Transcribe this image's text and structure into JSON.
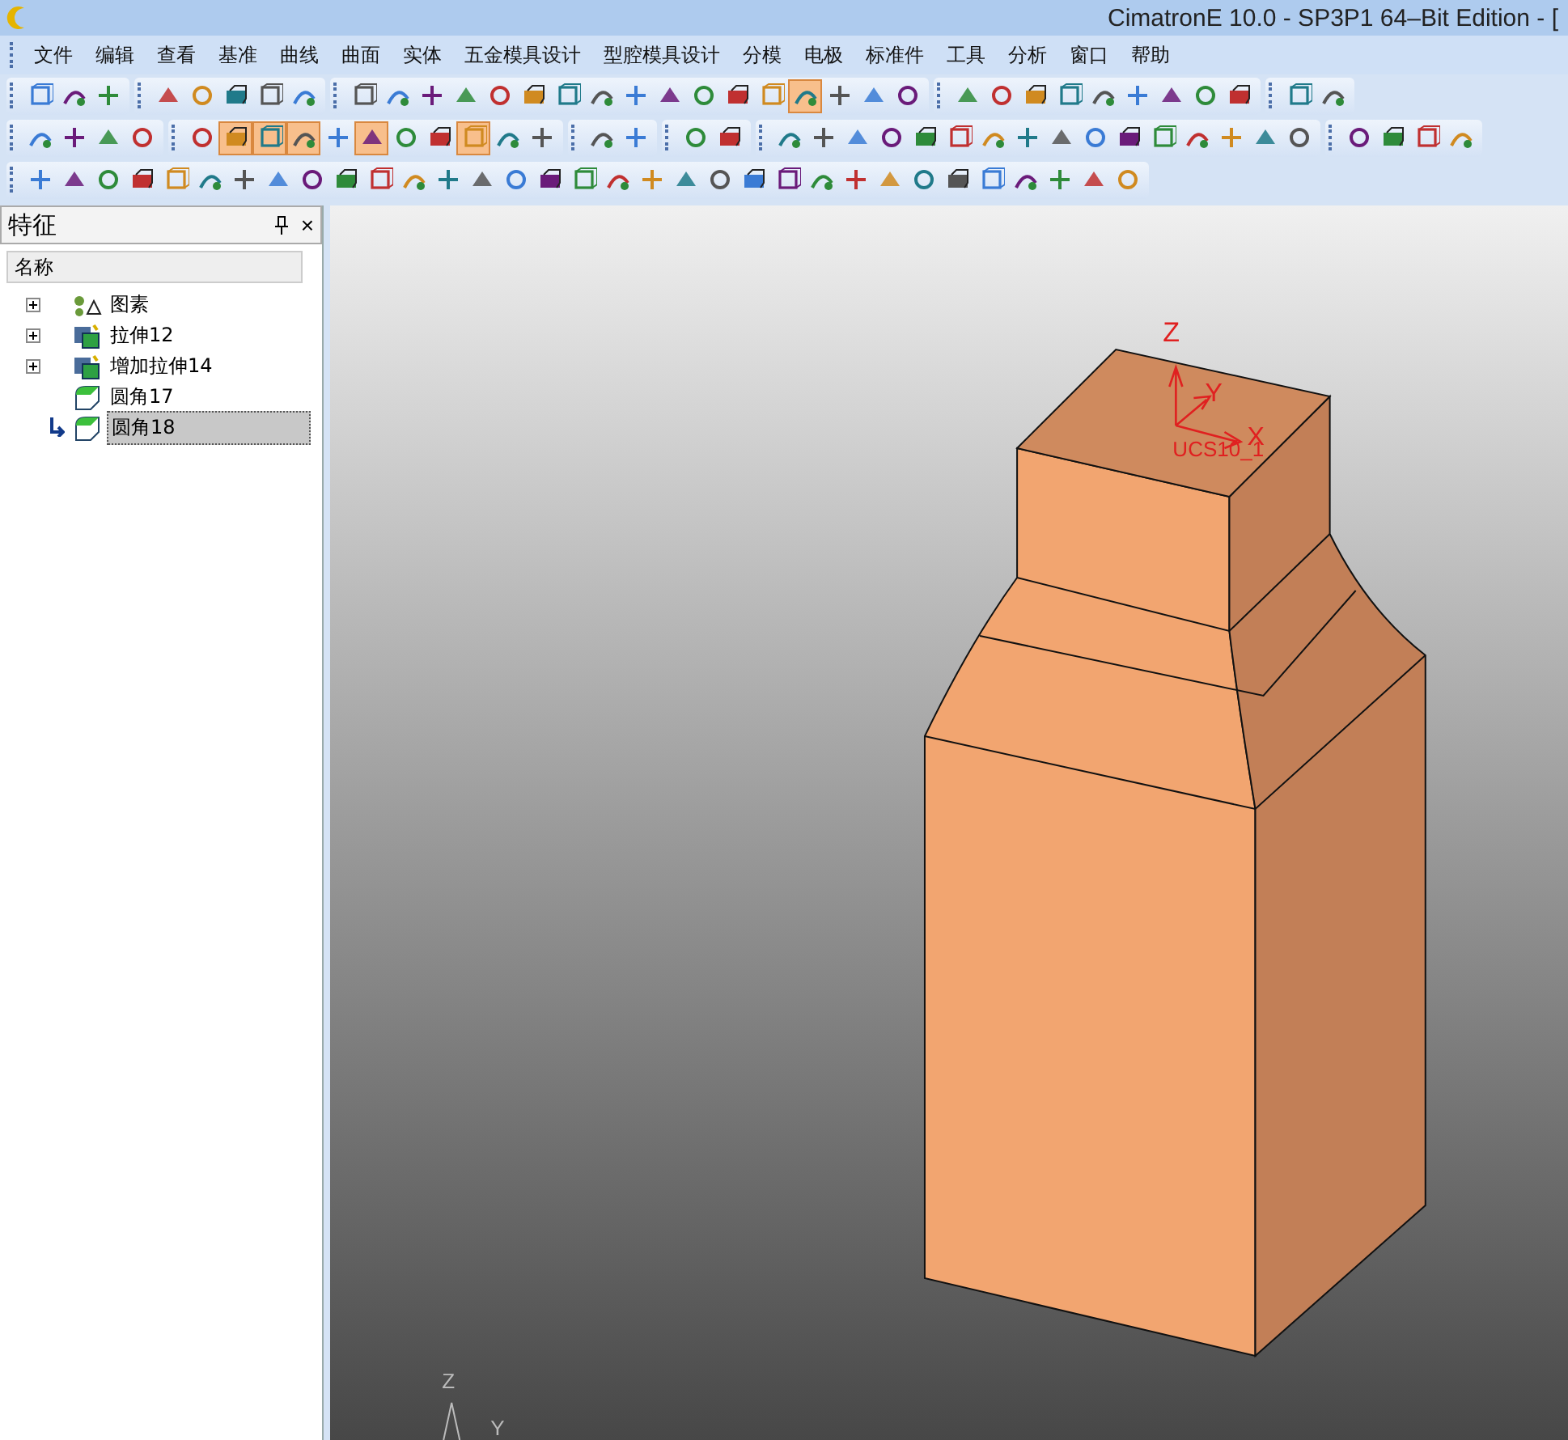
{
  "window": {
    "title": "CimatronE 10.0 - SP3P1 64–Bit Edition - ["
  },
  "menu": [
    "文件",
    "编辑",
    "查看",
    "基准",
    "曲线",
    "曲面",
    "实体",
    "五金模具设计",
    "型腔模具设计",
    "分模",
    "电极",
    "标准件",
    "工具",
    "分析",
    "窗口",
    "帮助"
  ],
  "toolbars": [
    {
      "groups": [
        [
          {
            "selected": false
          },
          {
            "selected": false
          },
          {
            "selected": false
          }
        ],
        [
          {
            "selected": false
          },
          {
            "selected": false
          },
          {
            "selected": false
          },
          {
            "selected": false
          },
          {
            "selected": false
          }
        ],
        [
          {
            "selected": false
          },
          {
            "selected": false
          },
          {
            "selected": false
          },
          {
            "selected": false
          },
          {
            "selected": false
          },
          {
            "selected": false
          },
          {
            "selected": false
          },
          {
            "selected": false
          },
          {
            "selected": false
          },
          {
            "selected": false
          },
          {
            "selected": false
          },
          {
            "selected": false
          },
          {
            "selected": false
          },
          {
            "selected": true
          },
          {
            "selected": false
          },
          {
            "selected": false
          },
          {
            "selected": false
          }
        ],
        [
          {
            "selected": false
          },
          {
            "selected": false
          },
          {
            "selected": false
          },
          {
            "selected": false
          },
          {
            "selected": false
          },
          {
            "selected": false
          },
          {
            "selected": false
          },
          {
            "selected": false
          },
          {
            "selected": false
          }
        ],
        [
          {
            "selected": false
          },
          {
            "selected": false
          }
        ]
      ]
    },
    {
      "groups": [
        [
          {
            "selected": false
          },
          {
            "selected": false
          },
          {
            "selected": false
          },
          {
            "selected": false
          }
        ],
        [
          {
            "selected": false
          },
          {
            "selected": true
          },
          {
            "selected": true
          },
          {
            "selected": true
          },
          {
            "selected": false
          },
          {
            "selected": true
          },
          {
            "selected": false
          },
          {
            "selected": false
          },
          {
            "selected": true
          },
          {
            "selected": false
          },
          {
            "selected": false
          }
        ],
        [
          {
            "selected": false
          },
          {
            "selected": false
          }
        ],
        [
          {
            "selected": false
          },
          {
            "selected": false
          }
        ],
        [
          {
            "selected": false
          },
          {
            "selected": false
          },
          {
            "selected": false
          },
          {
            "selected": false
          },
          {
            "selected": false
          },
          {
            "selected": false
          },
          {
            "selected": false
          },
          {
            "selected": false
          },
          {
            "selected": false
          },
          {
            "selected": false
          },
          {
            "selected": false
          },
          {
            "selected": false
          },
          {
            "selected": false
          },
          {
            "selected": false
          },
          {
            "selected": false
          },
          {
            "selected": false
          }
        ],
        [
          {
            "selected": false
          },
          {
            "selected": false
          },
          {
            "selected": false
          },
          {
            "selected": false
          }
        ]
      ]
    },
    {
      "groups": [
        [
          {
            "selected": false
          },
          {
            "selected": false
          },
          {
            "selected": false
          },
          {
            "selected": false
          },
          {
            "selected": false
          },
          {
            "selected": false
          },
          {
            "selected": false
          },
          {
            "selected": false
          },
          {
            "selected": false
          },
          {
            "selected": false
          },
          {
            "selected": false
          },
          {
            "selected": false
          },
          {
            "selected": false
          },
          {
            "selected": false
          },
          {
            "selected": false
          },
          {
            "selected": false
          },
          {
            "selected": false
          },
          {
            "selected": false
          },
          {
            "selected": false
          },
          {
            "selected": false
          },
          {
            "selected": false
          },
          {
            "selected": false
          },
          {
            "selected": false
          },
          {
            "selected": false
          },
          {
            "selected": false
          },
          {
            "selected": false
          },
          {
            "selected": false
          },
          {
            "selected": false
          },
          {
            "selected": false
          },
          {
            "selected": false
          },
          {
            "selected": false
          },
          {
            "selected": false
          },
          {
            "selected": false
          }
        ]
      ]
    }
  ],
  "feature_panel": {
    "title": "特征",
    "close": "×",
    "column": "名称",
    "items": [
      {
        "label": "图素",
        "kind": "sketch",
        "has_children": true,
        "selected": false,
        "current": false
      },
      {
        "label": "拉伸12",
        "kind": "extrude",
        "has_children": true,
        "selected": false,
        "current": false
      },
      {
        "label": "增加拉伸14",
        "kind": "extrude",
        "has_children": true,
        "selected": false,
        "current": false
      },
      {
        "label": "圆角17",
        "kind": "fillet",
        "has_children": false,
        "selected": false,
        "current": false
      },
      {
        "label": "圆角18",
        "kind": "fillet",
        "has_children": false,
        "selected": true,
        "current": true
      }
    ]
  },
  "viewport": {
    "ucs": {
      "z": "Z",
      "y": "Y",
      "x": "X",
      "name": "UCS10_1"
    },
    "axis": {
      "z": "Z",
      "y": "Y"
    }
  }
}
